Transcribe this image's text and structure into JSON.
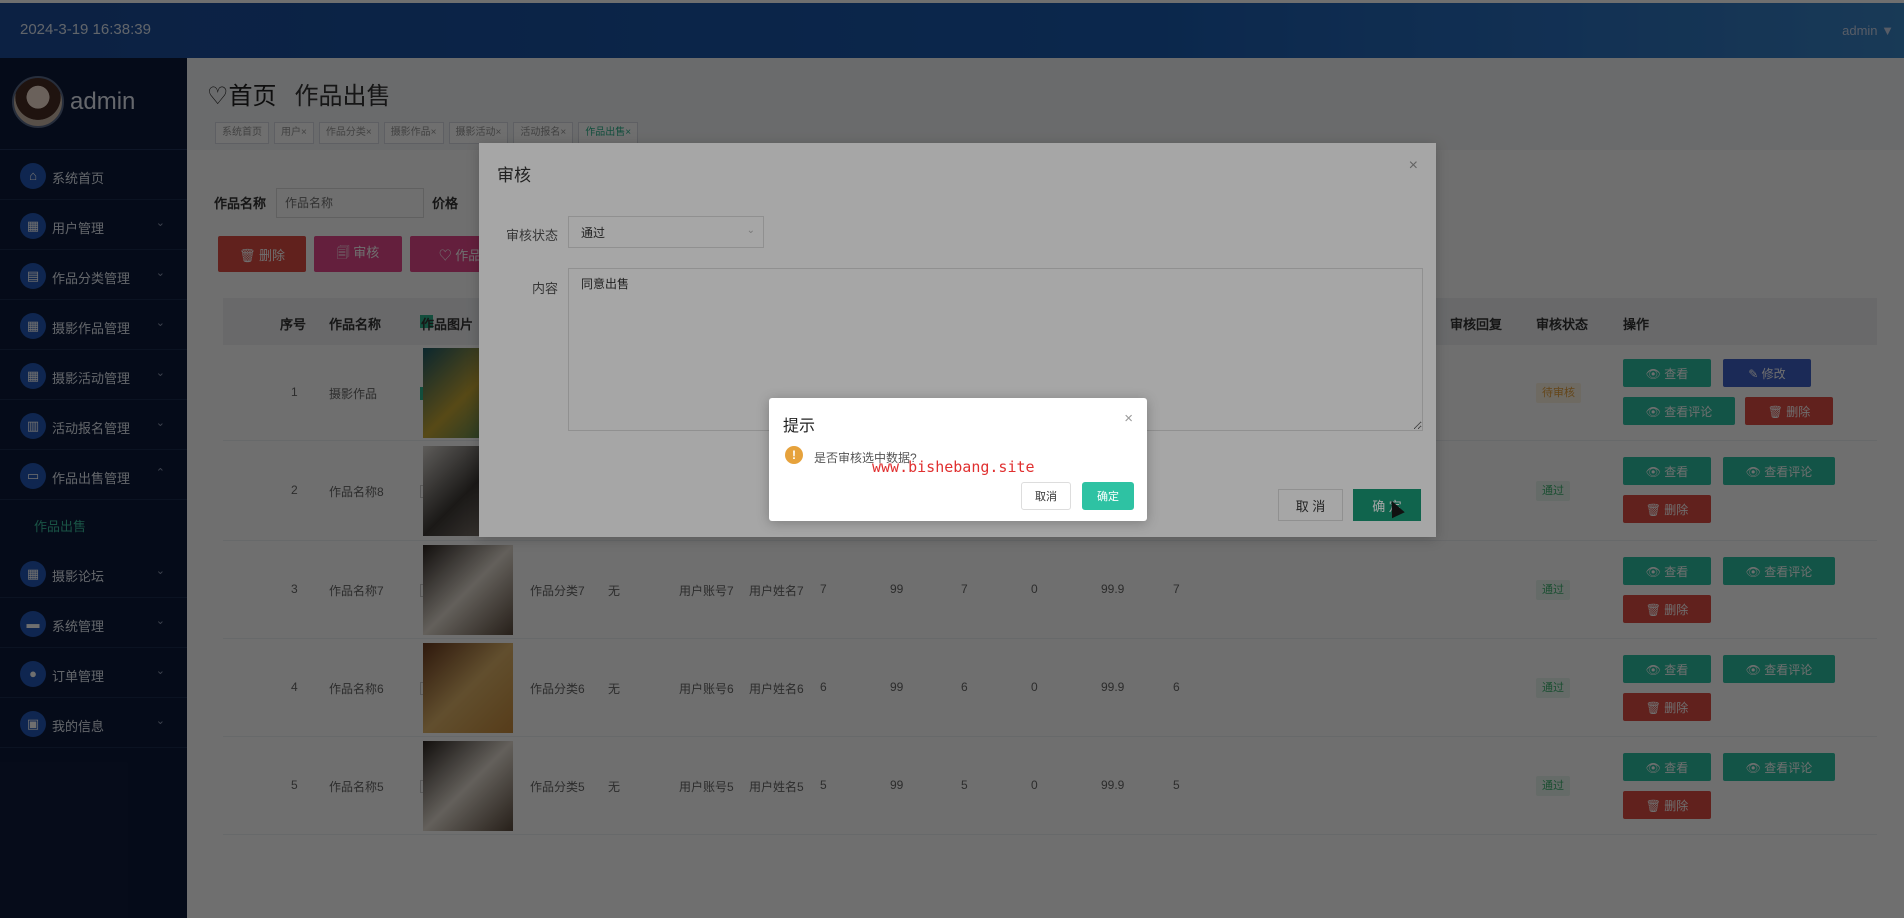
{
  "header": {
    "datetime": "2024-3-19 16:38:39",
    "user": "admin ▼"
  },
  "sidebar": {
    "username": "admin",
    "items": [
      {
        "label": "系统首页",
        "icon": "home-icon",
        "glyph": "⌂",
        "arrow": ""
      },
      {
        "label": "用户管理",
        "icon": "grid-icon",
        "glyph": "▦",
        "arrow": "⌄"
      },
      {
        "label": "作品分类管理",
        "icon": "category-icon",
        "glyph": "▤",
        "arrow": "⌄"
      },
      {
        "label": "摄影作品管理",
        "icon": "grid-icon",
        "glyph": "▦",
        "arrow": "⌄"
      },
      {
        "label": "摄影活动管理",
        "icon": "grid-icon",
        "glyph": "▦",
        "arrow": "⌄"
      },
      {
        "label": "活动报名管理",
        "icon": "clipboard-icon",
        "glyph": "▥",
        "arrow": "⌄"
      },
      {
        "label": "作品出售管理",
        "icon": "shop-icon",
        "glyph": "▭",
        "arrow": "⌃"
      },
      {
        "label": "摄影论坛",
        "icon": "grid-icon",
        "glyph": "▦",
        "arrow": "⌄"
      },
      {
        "label": "系统管理",
        "icon": "chat-icon",
        "glyph": "▬",
        "arrow": "⌄"
      },
      {
        "label": "订单管理",
        "icon": "person-icon",
        "glyph": "●",
        "arrow": "⌄"
      },
      {
        "label": "我的信息",
        "icon": "card-icon",
        "glyph": "▣",
        "arrow": "⌄"
      }
    ],
    "submenu_label": "作品出售"
  },
  "breadcrumb": {
    "home": "♡首页",
    "current": "作品出售"
  },
  "tags": [
    "系统首页",
    "用户×",
    "作品分类×",
    "摄影作品×",
    "摄影活动×",
    "活动报名×",
    "作品出售×"
  ],
  "search": {
    "name_label": "作品名称",
    "name_placeholder": "作品名称",
    "price_label": "价格"
  },
  "toolbar": {
    "delete": "🗑 删除",
    "audit": "🗐 审核",
    "work": "♡ 作品"
  },
  "table": {
    "headers": {
      "index": "序号",
      "name": "作品名称",
      "image": "作品图片",
      "reply": "审核回复",
      "status": "审核状态",
      "action": "操作"
    },
    "rows": [
      {
        "no": "1",
        "name": "摄影作品",
        "category": "",
        "none": "",
        "account": "",
        "uname": "",
        "c1": "",
        "c2": "",
        "c3": "",
        "c4": "",
        "c5": "",
        "c6": "",
        "status": "待审核",
        "status_type": "wait",
        "checked": true,
        "img": [
          "#1d5b6a",
          "#c9a935",
          "#2c7a63"
        ]
      },
      {
        "no": "2",
        "name": "作品名称8",
        "category": "",
        "none": "",
        "account": "",
        "uname": "",
        "c1": "",
        "c2": "",
        "c3": "",
        "c4": "",
        "c5": "",
        "c6": "",
        "status": "通过",
        "status_type": "pass",
        "checked": false,
        "img": [
          "#d8d4cf",
          "#3e3a36",
          "#9b8f86"
        ]
      },
      {
        "no": "3",
        "name": "作品名称7",
        "category": "作品分类7",
        "none": "无",
        "account": "用户账号7",
        "uname": "用户姓名7",
        "c1": "7",
        "c2": "99",
        "c3": "7",
        "c4": "0",
        "c5": "99.9",
        "c6": "7",
        "status": "通过",
        "status_type": "pass",
        "checked": false,
        "img": [
          "#2b2420",
          "#e5ddd2",
          "#5a4a3c"
        ]
      },
      {
        "no": "4",
        "name": "作品名称6",
        "category": "作品分类6",
        "none": "无",
        "account": "用户账号6",
        "uname": "用户姓名6",
        "c1": "6",
        "c2": "99",
        "c3": "6",
        "c4": "0",
        "c5": "99.9",
        "c6": "6",
        "status": "通过",
        "status_type": "pass",
        "checked": false,
        "img": [
          "#6b3a1f",
          "#e0b56a",
          "#c78b3c"
        ]
      },
      {
        "no": "5",
        "name": "作品名称5",
        "category": "作品分类5",
        "none": "无",
        "account": "用户账号5",
        "uname": "用户姓名5",
        "c1": "5",
        "c2": "99",
        "c3": "5",
        "c4": "0",
        "c5": "99.9",
        "c6": "5",
        "status": "通过",
        "status_type": "pass",
        "checked": false,
        "img": [
          "#2b2420",
          "#e5ddd2",
          "#5a4a3c"
        ]
      }
    ],
    "actions": {
      "view": "👁 查看",
      "edit": "✎ 修改",
      "comments": "👁 查看评论",
      "delete": "🗑 删除"
    }
  },
  "audit_dialog": {
    "title": "审核",
    "close": "×",
    "status_label": "审核状态",
    "status_value": "通过",
    "content_label": "内容",
    "content_value": "同意出售",
    "cancel": "取 消",
    "confirm": "确 定"
  },
  "confirm_box": {
    "title": "提示",
    "close": "×",
    "icon": "!",
    "message": "是否审核选中数据?",
    "watermark": "www.bishebang.site",
    "cancel": "取消",
    "ok": "确定"
  }
}
